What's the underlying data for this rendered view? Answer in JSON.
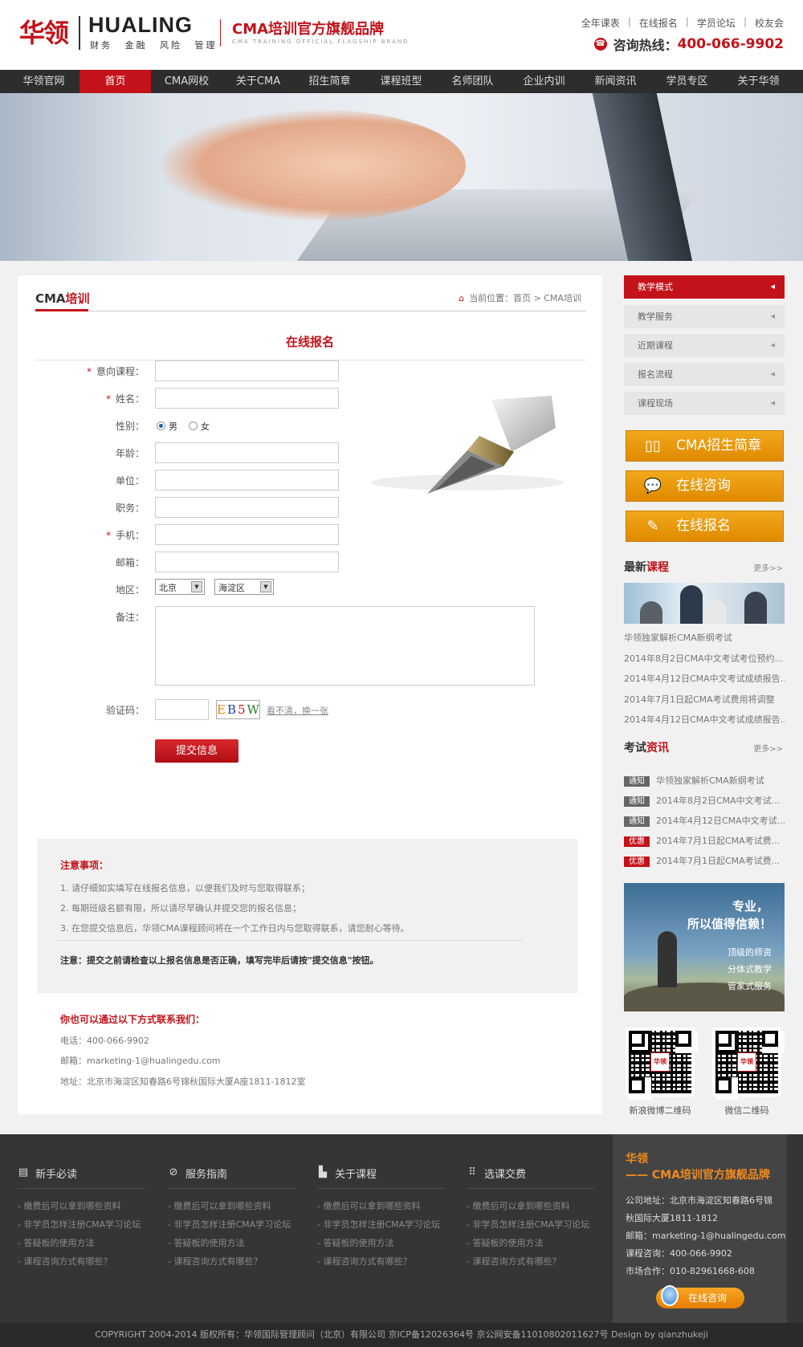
{
  "header": {
    "logo_cn": "华领",
    "logo_en": "HUALING",
    "logo_sub": "财务 金融 风险 管理",
    "slogan": "CMA培训官方旗舰品牌",
    "slogan_en": "CMA TRAINING OFFICIAL FLAGSHIP BRAND",
    "toplinks": [
      "全年课表",
      "在线报名",
      "学员论坛",
      "校友会"
    ],
    "hotline_label": "咨询热线：",
    "hotline_number": "400-066-9902"
  },
  "nav": {
    "items": [
      "华领官网",
      "首页",
      "CMA网校",
      "关于CMA",
      "招生简章",
      "课程班型",
      "名师团队",
      "企业内训",
      "新闻资讯",
      "学员专区",
      "关于华领"
    ],
    "active_index": 1
  },
  "main": {
    "title_a": "CMA",
    "title_b": "培训",
    "breadcrumb": "当前位置：首页 > CMA培训",
    "form_title": "在线报名",
    "fields": {
      "course": "意向课程：",
      "name": "姓名：",
      "gender": "性别：",
      "gender_male": "男",
      "gender_female": "女",
      "age": "年龄：",
      "company": "单位：",
      "position": "职务：",
      "mobile": "手机：",
      "email": "邮箱：",
      "region": "地区：",
      "city": "北京",
      "district": "海淀区",
      "remark": "备注：",
      "captcha": "验证码：",
      "captcha_text": [
        "E",
        "B",
        "5",
        "W"
      ],
      "captcha_refresh": "看不清，换一张",
      "submit": "提交信息"
    },
    "notice": {
      "title": "注意事项：",
      "items": [
        "1. 请仔细如实填写在线报名信息，以便我们及时与您取得联系；",
        "2. 每期班级名额有限，所以请尽早确认并提交您的报名信息；",
        "3. 在您提交信息后，华领CMA课程顾问将在一个工作日内与您取得联系，请您耐心等待。"
      ],
      "final": "注意：提交之前请检查以上报名信息是否正确，填写完毕后请按\"提交信息\"按钮。"
    },
    "contact": {
      "title": "你也可以通过以下方式联系我们：",
      "phone": "电话：400-066-9902",
      "email": "邮箱：marketing-1@hualingedu.com",
      "address": "地址：北京市海淀区知春路6号锦秋国际大厦A座1811-1812室"
    }
  },
  "sidebar": {
    "menu": [
      "教学模式",
      "教学服务",
      "近期课程",
      "报名流程",
      "课程现场"
    ],
    "active_menu": 0,
    "buttons": [
      "CMA招生简章",
      "在线咨询",
      "在线报名"
    ],
    "courses_title_a": "最新",
    "courses_title_b": "课程",
    "more": "更多>>",
    "courses": [
      "华领独家解析CMA新纲考试",
      "2014年8月2日CMA中文考试考位预约...",
      "2014年4月12日CMA中文考试成绩报告...",
      "2014年7月1日起CMA考试费用将调整",
      "2014年4月12日CMA中文考试成绩报告..."
    ],
    "news_title_a": "考试",
    "news_title_b": "资讯",
    "news": [
      {
        "tag": "通知",
        "tag_color": "#666666",
        "text": "华领独家解析CMA新纲考试"
      },
      {
        "tag": "通知",
        "tag_color": "#666666",
        "text": "2014年8月2日CMA中文考试..."
      },
      {
        "tag": "通知",
        "tag_color": "#666666",
        "text": "2014年4月12日CMA中文考试..."
      },
      {
        "tag": "优惠",
        "tag_color": "#c4121a",
        "text": "2014年7月1日起CMA考试费..."
      },
      {
        "tag": "优惠",
        "tag_color": "#c4121a",
        "text": "2014年7月1日起CMA考试费..."
      }
    ],
    "ad": {
      "line1": "专业，",
      "line2": "所以值得信赖！",
      "points": [
        "顶级的师资",
        "分体式教学",
        "管家式服务"
      ]
    },
    "qr_labels": [
      "新浪微博二维码",
      "微信二维码"
    ],
    "qr_mark": "华领"
  },
  "footer": {
    "columns": [
      {
        "title": "新手必读",
        "icon": "book-icon",
        "links": [
          "缴费后可以拿到哪些资料",
          "非学员怎样注册CMA学习论坛",
          "答疑板的使用方法",
          "课程咨询方式有哪些？"
        ]
      },
      {
        "title": "服务指南",
        "icon": "compass-icon",
        "links": [
          "缴费后可以拿到哪些资料",
          "非学员怎样注册CMA学习论坛",
          "答疑板的使用方法",
          "课程咨询方式有哪些？"
        ]
      },
      {
        "title": "关于课程",
        "icon": "document-icon",
        "links": [
          "缴费后可以拿到哪些资料",
          "非学员怎样注册CMA学习论坛",
          "答疑板的使用方法",
          "课程咨询方式有哪些？"
        ]
      },
      {
        "title": "选课交费",
        "icon": "grid-icon",
        "links": [
          "缴费后可以拿到哪些资料",
          "非学员怎样注册CMA学习论坛",
          "答疑板的使用方法",
          "课程咨询方式有哪些？"
        ]
      }
    ],
    "brand": "华领",
    "slogan": "—— CMA培训官方旗舰品牌",
    "address1": "公司地址：北京市海淀区知春路6号锦",
    "address2": "秋国际大厦1811-1812",
    "email": "邮箱：marketing-1@hualingedu.com",
    "consult": "课程咨询：400-066-9902",
    "market": "市场合作：010-82961668-608",
    "online_button": "在线咨询",
    "copyright": "COPYRIGHT  2004-2014 版权所有：华领国际管理顾问（北京）有限公司 京ICP备12026364号 京公网安备11010802011627号    Design by qianzhukeji"
  }
}
